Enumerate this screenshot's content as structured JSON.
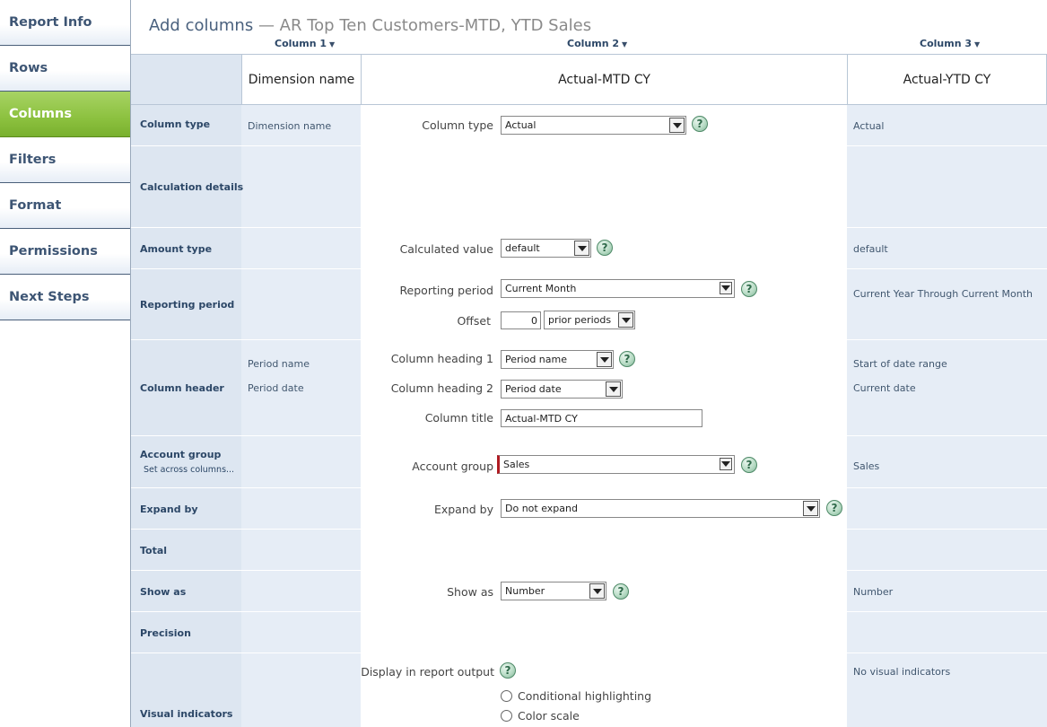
{
  "sidebar": {
    "items": [
      {
        "label": "Report Info",
        "active": false
      },
      {
        "label": "Rows",
        "active": false
      },
      {
        "label": "Columns",
        "active": true
      },
      {
        "label": "Filters",
        "active": false
      },
      {
        "label": "Format",
        "active": false
      },
      {
        "label": "Permissions",
        "active": false
      },
      {
        "label": "Next Steps",
        "active": false
      }
    ]
  },
  "header": {
    "title": "Add columns",
    "subtitle": "— AR Top Ten Customers-MTD, YTD Sales"
  },
  "columns": {
    "col1": {
      "title": "Column 1",
      "heading": "Dimension name"
    },
    "col2": {
      "title": "Column 2",
      "heading": "Actual-MTD CY"
    },
    "col3": {
      "title": "Column 3",
      "heading": "Actual-YTD CY"
    }
  },
  "rows": {
    "column_type": "Column type",
    "calculation_details": "Calculation details",
    "amount_type": "Amount type",
    "reporting_period": "Reporting period",
    "column_header": "Column header",
    "account_group": "Account group",
    "account_group_sub": "Set across columns...",
    "expand_by": "Expand by",
    "total": "Total",
    "show_as": "Show as",
    "precision": "Precision",
    "visual_indicators": "Visual indicators"
  },
  "col1_values": {
    "column_type": "Dimension name",
    "period_name": "Period name",
    "period_date": "Period date"
  },
  "form": {
    "column_type": {
      "label": "Column type",
      "value": "Actual"
    },
    "calculated_value": {
      "label": "Calculated value",
      "value": "default"
    },
    "reporting_period": {
      "label": "Reporting period",
      "value": "Current Month"
    },
    "offset": {
      "label": "Offset",
      "value": "0",
      "unit": "prior periods"
    },
    "column_heading_1": {
      "label": "Column heading 1",
      "value": "Period name"
    },
    "column_heading_2": {
      "label": "Column heading 2",
      "value": "Period date"
    },
    "column_title": {
      "label": "Column title",
      "value": "Actual-MTD CY"
    },
    "account_group": {
      "label": "Account group",
      "value": "Sales"
    },
    "expand_by": {
      "label": "Expand by",
      "value": "Do not expand"
    },
    "show_as": {
      "label": "Show as",
      "value": "Number"
    },
    "display_output": {
      "label": "Display in report output"
    },
    "radio_options": [
      "Conditional highlighting",
      "Color scale"
    ],
    "help_glyph": "?"
  },
  "col3_values": {
    "column_type": "Actual",
    "amount_type": "default",
    "reporting_period": "Current Year Through Current Month",
    "heading_1": "Start of date range",
    "heading_2": "Current date",
    "account_group": "Sales",
    "show_as": "Number",
    "visual_indicators": "No visual indicators"
  },
  "colors": {
    "accent_green": "#8cc13f",
    "nav_text": "#3d5574",
    "label_bg": "#dde6f1",
    "required_marker": "#b01b22"
  }
}
